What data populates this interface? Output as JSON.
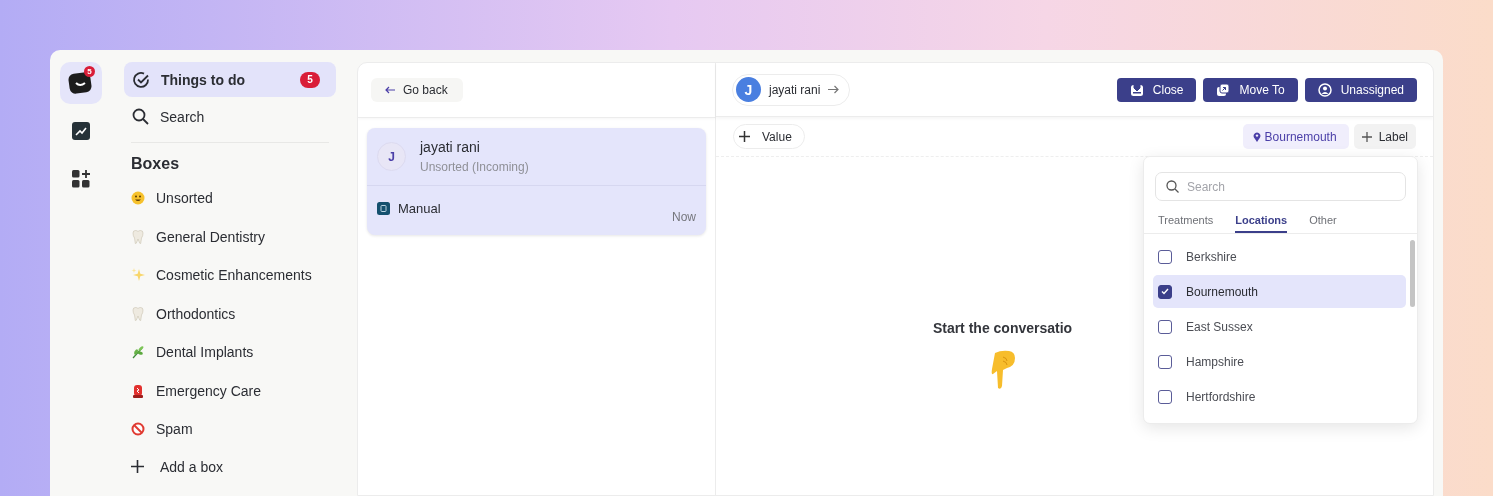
{
  "rail": {
    "badge": "5",
    "items": [
      {
        "kind": "logo",
        "selected": true
      },
      {
        "kind": "chart",
        "selected": false
      },
      {
        "kind": "apps",
        "selected": false
      }
    ]
  },
  "sidebar": {
    "nav": [
      {
        "label": "Things to do",
        "kind": "todo",
        "badge": "5",
        "selected": true
      },
      {
        "label": "Search",
        "kind": "search",
        "selected": false
      }
    ],
    "section_title": "Boxes",
    "boxes": [
      {
        "label": "Unsorted",
        "kind": "smiley"
      },
      {
        "label": "General Dentistry",
        "kind": "tooth"
      },
      {
        "label": "Cosmetic Enhancements",
        "kind": "sparkles"
      },
      {
        "label": "Orthodontics",
        "kind": "tooth"
      },
      {
        "label": "Dental Implants",
        "kind": "herb"
      },
      {
        "label": "Emergency Care",
        "kind": "siren"
      },
      {
        "label": "Spam",
        "kind": "prohibited"
      }
    ],
    "add_box": "Add a box"
  },
  "list": {
    "back": "Go back",
    "conversations": [
      {
        "initial": "J",
        "name": "jayati rani",
        "box": "Unsorted (Incoming)",
        "source": "Manual",
        "time": "Now",
        "selected": true
      }
    ]
  },
  "conversation": {
    "contact": {
      "initial": "J",
      "name": "jayati rani"
    },
    "actions": [
      {
        "label": "Close",
        "kind": "close"
      },
      {
        "label": "Move To",
        "kind": "move"
      },
      {
        "label": "Unassigned",
        "kind": "assign"
      }
    ],
    "value_button": "Value",
    "labels": [
      {
        "label": "Bournemouth",
        "kind": "location"
      }
    ],
    "label_button": "Label",
    "empty_text": "Start the conversatio"
  },
  "label_popup": {
    "search_placeholder": "Search",
    "tabs": [
      {
        "label": "Treatments",
        "selected": false
      },
      {
        "label": "Locations",
        "selected": true
      },
      {
        "label": "Other",
        "selected": false
      }
    ],
    "options": [
      {
        "label": "Berkshire",
        "checked": false
      },
      {
        "label": "Bournemouth",
        "checked": true
      },
      {
        "label": "East Sussex",
        "checked": false
      },
      {
        "label": "Hampshire",
        "checked": false
      },
      {
        "label": "Hertfordshire",
        "checked": false
      }
    ]
  }
}
